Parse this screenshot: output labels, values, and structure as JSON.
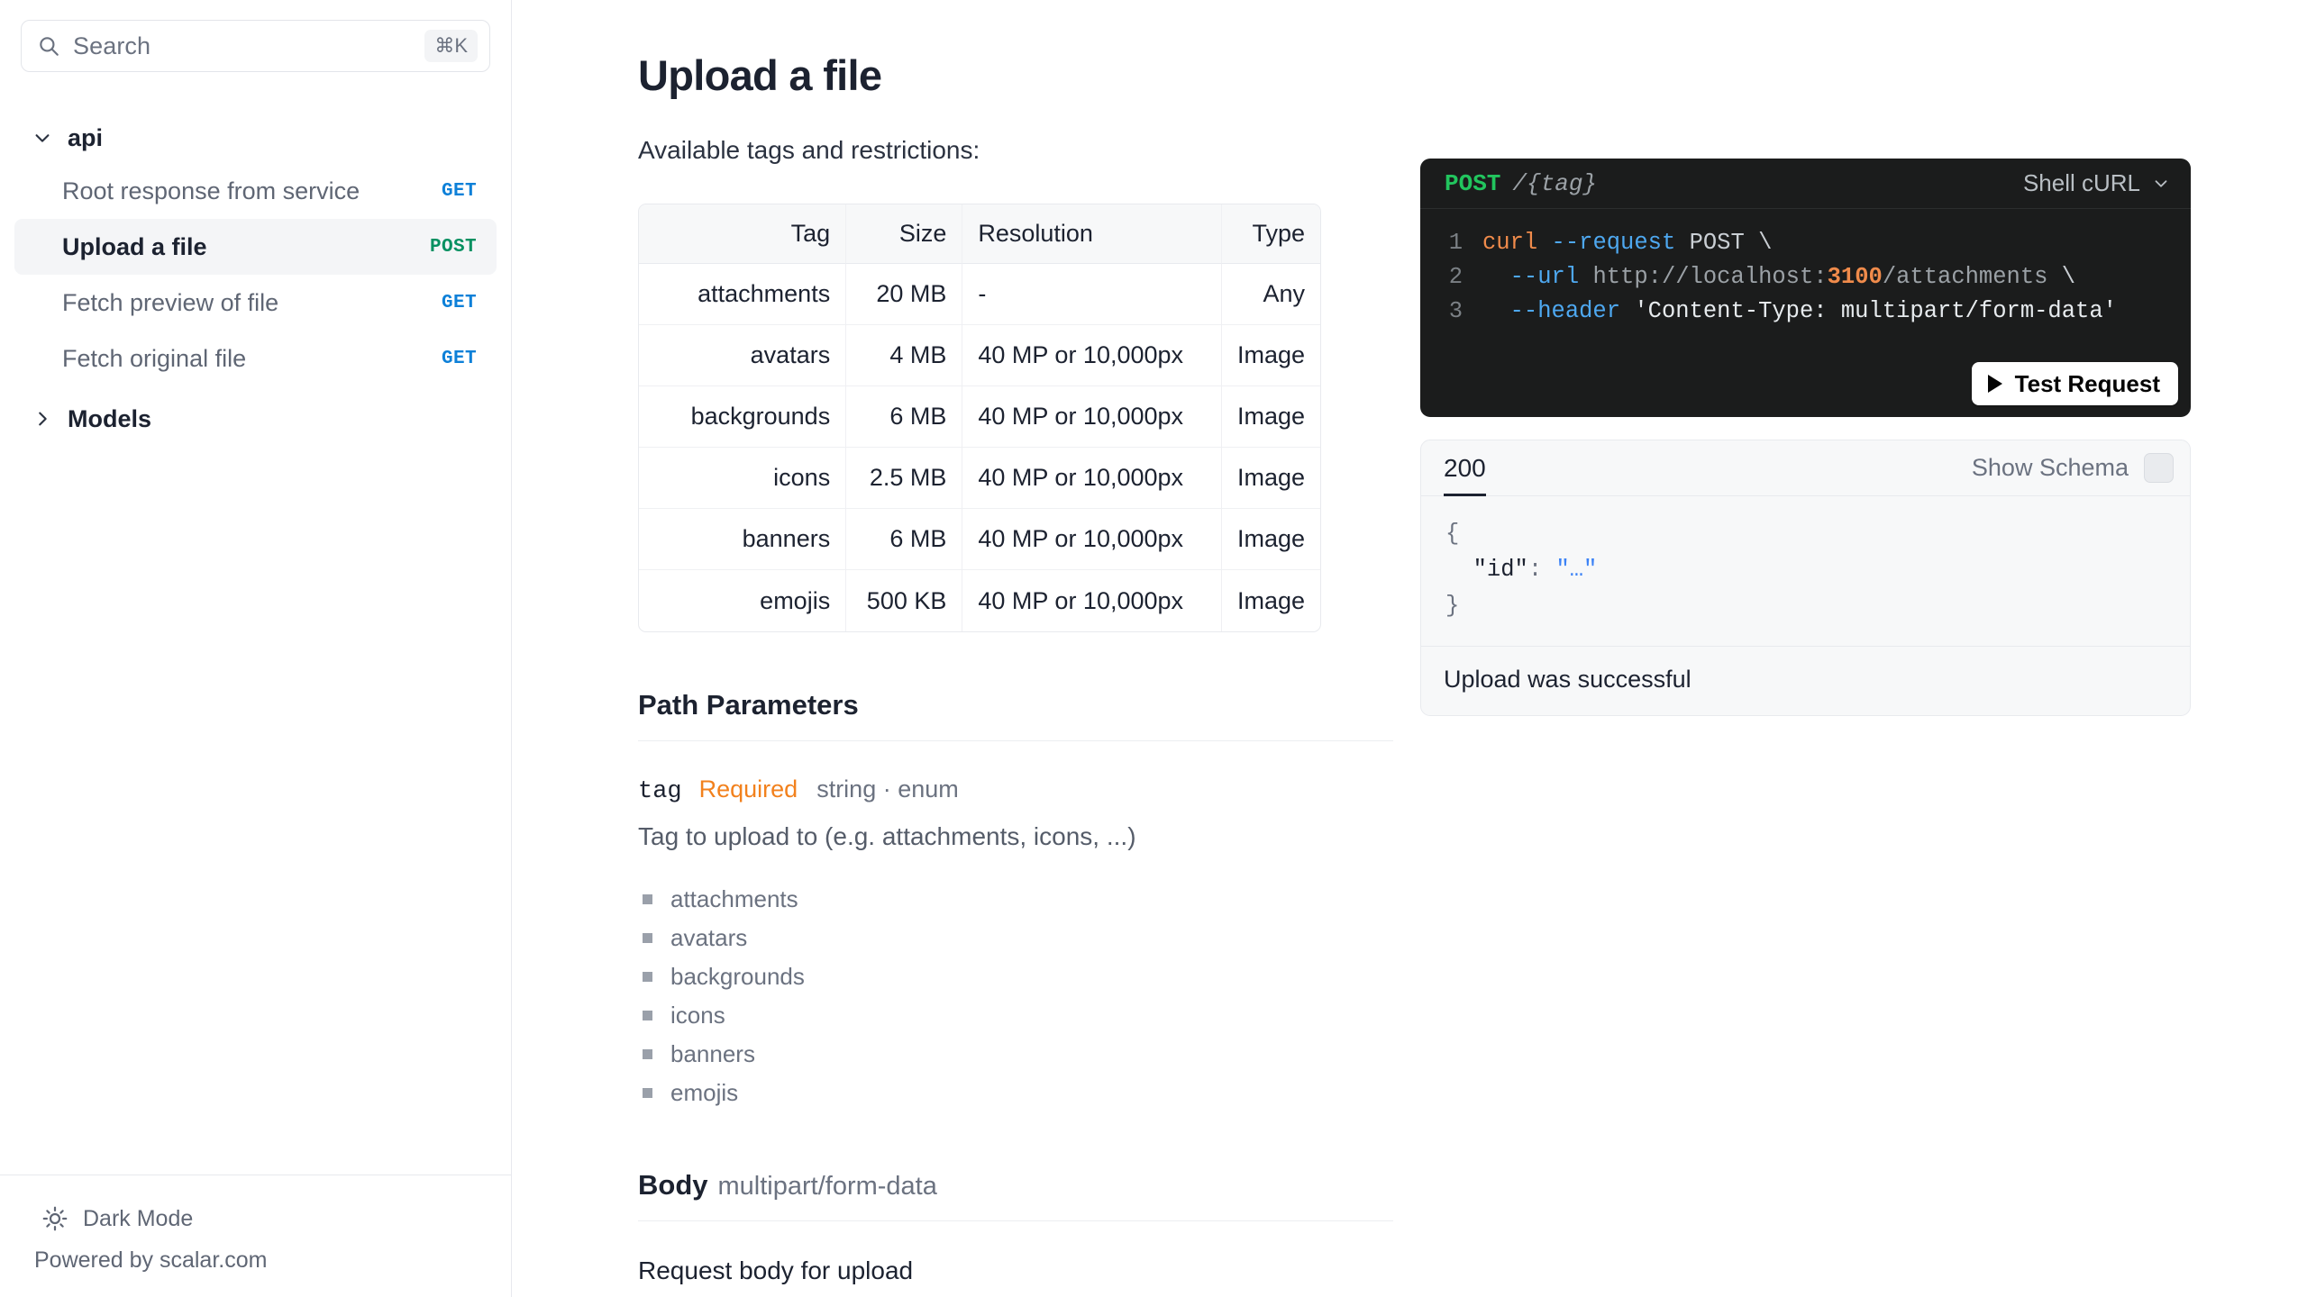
{
  "sidebar": {
    "search": {
      "placeholder": "Search",
      "shortcut": "⌘K",
      "icon": "search-icon"
    },
    "groups": [
      {
        "label": "api",
        "expanded": true,
        "items": [
          {
            "label": "Root response from service",
            "method": "GET",
            "active": false
          },
          {
            "label": "Upload a file",
            "method": "POST",
            "active": true
          },
          {
            "label": "Fetch preview of file",
            "method": "GET",
            "active": false
          },
          {
            "label": "Fetch original file",
            "method": "GET",
            "active": false
          }
        ]
      },
      {
        "label": "Models",
        "expanded": false,
        "items": []
      }
    ],
    "footer": {
      "dark_mode_label": "Dark Mode",
      "dark_mode_icon": "sun-icon",
      "powered_by": "Powered by scalar.com"
    }
  },
  "doc": {
    "title": "Upload a file",
    "intro": "Available tags and restrictions:",
    "table": {
      "headers": [
        "Tag",
        "Size",
        "Resolution",
        "Type"
      ],
      "rows": [
        [
          "attachments",
          "20 MB",
          "-",
          "Any"
        ],
        [
          "avatars",
          "4 MB",
          "40 MP or 10,000px",
          "Image"
        ],
        [
          "backgrounds",
          "6 MB",
          "40 MP or 10,000px",
          "Image"
        ],
        [
          "icons",
          "2.5 MB",
          "40 MP or 10,000px",
          "Image"
        ],
        [
          "banners",
          "6 MB",
          "40 MP or 10,000px",
          "Image"
        ],
        [
          "emojis",
          "500 KB",
          "40 MP or 10,000px",
          "Image"
        ]
      ]
    },
    "path_parameters": {
      "heading": "Path Parameters",
      "param": {
        "name": "tag",
        "required_label": "Required",
        "type": "string · enum",
        "description": "Tag to upload to (e.g. attachments, icons, ...)",
        "enum": [
          "attachments",
          "avatars",
          "backgrounds",
          "icons",
          "banners",
          "emojis"
        ]
      }
    },
    "body": {
      "heading": "Body",
      "mime": "multipart/form-data",
      "description": "Request body for upload"
    }
  },
  "code_panel": {
    "method": "POST",
    "path": "/{tag}",
    "language_label": "Shell cURL",
    "lines": [
      {
        "n": "1",
        "parts": [
          {
            "t": "cmd",
            "v": "curl"
          },
          {
            "t": "sp",
            "v": " "
          },
          {
            "t": "flag",
            "v": "--request"
          },
          {
            "t": "sp",
            "v": " "
          },
          {
            "t": "plain",
            "v": "POST"
          },
          {
            "t": "sp",
            "v": " "
          },
          {
            "t": "plain",
            "v": "\\"
          }
        ]
      },
      {
        "n": "2",
        "parts": [
          {
            "t": "sp",
            "v": "  "
          },
          {
            "t": "flag",
            "v": "--url"
          },
          {
            "t": "sp",
            "v": " "
          },
          {
            "t": "dim",
            "v": "http://localhost:"
          },
          {
            "t": "num",
            "v": "3100"
          },
          {
            "t": "dim",
            "v": "/attachments"
          },
          {
            "t": "sp",
            "v": " "
          },
          {
            "t": "plain",
            "v": "\\"
          }
        ]
      },
      {
        "n": "3",
        "parts": [
          {
            "t": "sp",
            "v": "  "
          },
          {
            "t": "flag",
            "v": "--header"
          },
          {
            "t": "sp",
            "v": " "
          },
          {
            "t": "str",
            "v": "'Content-Type: multipart/form-data'"
          }
        ]
      }
    ],
    "test_button": "Test Request"
  },
  "response_panel": {
    "status": "200",
    "show_schema_label": "Show Schema",
    "schema_checked": false,
    "json_lines": [
      {
        "parts": [
          {
            "t": "p",
            "v": "{"
          }
        ]
      },
      {
        "parts": [
          {
            "t": "p",
            "v": "  "
          },
          {
            "t": "key",
            "v": "\"id\""
          },
          {
            "t": "p",
            "v": ": "
          },
          {
            "t": "str",
            "v": "\"…\""
          }
        ]
      },
      {
        "parts": [
          {
            "t": "p",
            "v": "}"
          }
        ]
      }
    ],
    "note": "Upload was successful"
  },
  "colors": {
    "method_get": "#0d80d8",
    "method_post": "#069061",
    "required": "#f2811d",
    "code_bg": "#1b1c1c",
    "code_method": "#22c55e",
    "json_string": "#3b82f6"
  }
}
